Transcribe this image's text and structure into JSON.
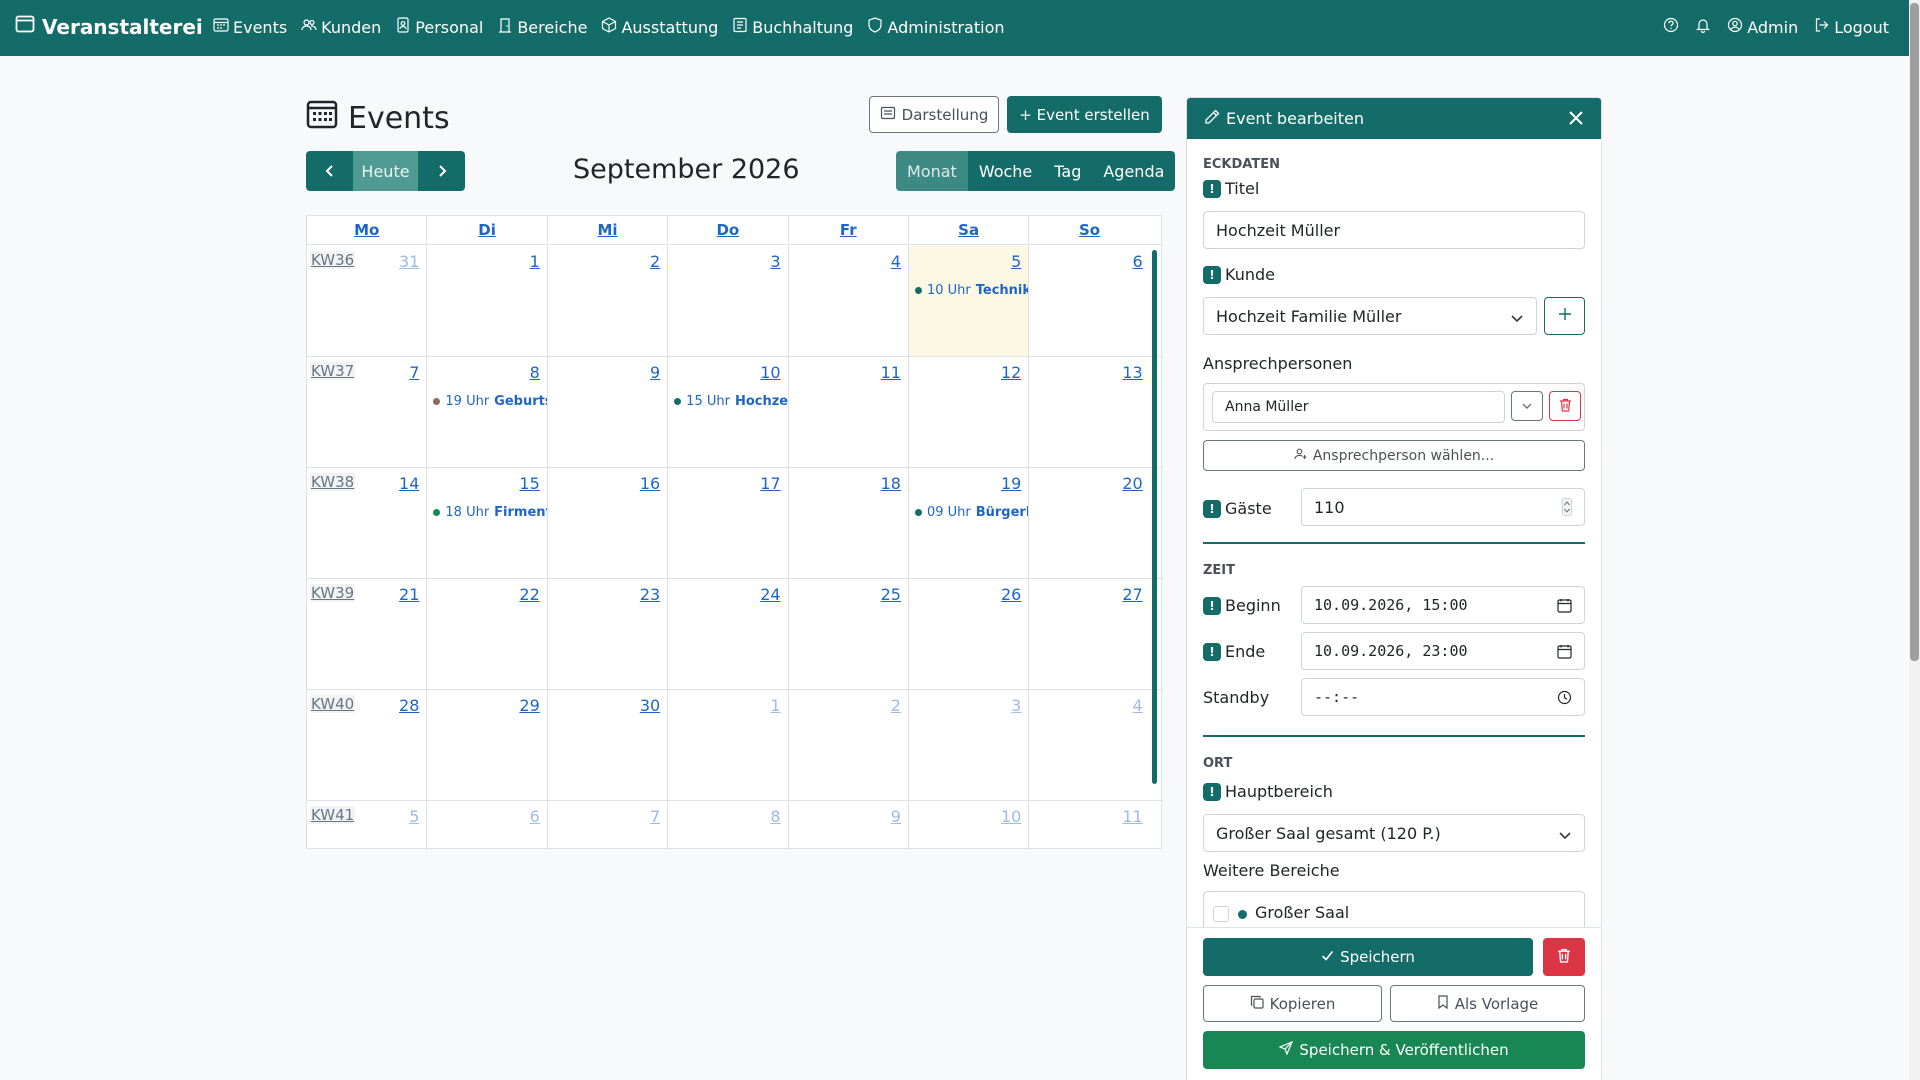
{
  "brand": "Veranstalterei",
  "nav": {
    "items": [
      "Events",
      "Kunden",
      "Personal",
      "Bereiche",
      "Ausstattung",
      "Buchhaltung",
      "Administration"
    ],
    "user": "Admin",
    "logout": "Logout"
  },
  "page": {
    "title": "Events",
    "darstellung": "Darstellung",
    "create": "+ Event erstellen"
  },
  "calendar": {
    "month_label": "September 2026",
    "today_label": "Heute",
    "views": [
      "Monat",
      "Woche",
      "Tag",
      "Agenda"
    ],
    "active_view": "Monat",
    "weekdays": [
      "Mo",
      "Di",
      "Mi",
      "Do",
      "Fr",
      "Sa",
      "So"
    ],
    "weeks": [
      {
        "kw": "KW36",
        "days": [
          "31",
          "1",
          "2",
          "3",
          "4",
          "5",
          "6"
        ]
      },
      {
        "kw": "KW37",
        "days": [
          "7",
          "8",
          "9",
          "10",
          "11",
          "12",
          "13"
        ]
      },
      {
        "kw": "KW38",
        "days": [
          "14",
          "15",
          "16",
          "17",
          "18",
          "19",
          "20"
        ]
      },
      {
        "kw": "KW39",
        "days": [
          "21",
          "22",
          "23",
          "24",
          "25",
          "26",
          "27"
        ]
      },
      {
        "kw": "KW40",
        "days": [
          "28",
          "29",
          "30",
          "1",
          "2",
          "3",
          "4"
        ]
      },
      {
        "kw": "KW41",
        "days": [
          "5",
          "6",
          "7",
          "8",
          "9",
          "10",
          "11"
        ]
      }
    ],
    "events": [
      {
        "week": 0,
        "day": 5,
        "time": "10 Uhr",
        "title": "Technikc",
        "color": "#146c68"
      },
      {
        "week": 1,
        "day": 1,
        "time": "19 Uhr",
        "title": "Geburtst",
        "color": "#8a6d5a"
      },
      {
        "week": 1,
        "day": 3,
        "time": "15 Uhr",
        "title": "Hochzeit",
        "color": "#146c68"
      },
      {
        "week": 2,
        "day": 1,
        "time": "18 Uhr",
        "title": "Firmenfe",
        "color": "#198754"
      },
      {
        "week": 2,
        "day": 5,
        "time": "09 Uhr",
        "title": "Bürgerkc",
        "color": "#146c68"
      }
    ]
  },
  "panel": {
    "header": "Event bearbeiten",
    "sections": {
      "eckdaten": "ECKDATEN",
      "zeit": "ZEIT",
      "ort": "ORT"
    },
    "labels": {
      "titel": "Titel",
      "kunde": "Kunde",
      "ansprechpersonen": "Ansprechpersonen",
      "gaeste": "Gäste",
      "beginn": "Beginn",
      "ende": "Ende",
      "standby": "Standby",
      "hauptbereich": "Hauptbereich",
      "weitere": "Weitere Bereiche"
    },
    "values": {
      "titel": "Hochzeit Müller",
      "kunde": "Hochzeit Familie Müller",
      "ansprechperson": "Anna Müller",
      "ansprechperson_waehlen": "Ansprechperson wählen...",
      "gaeste": "110",
      "beginn": "10.09.2026, 15:00",
      "ende": "10.09.2026, 23:00",
      "standby": "--:--",
      "hauptbereich": "Großer Saal gesamt (120 P.)",
      "weiterer_bereich": "Großer Saal"
    },
    "req_mark": "!",
    "buttons": {
      "save": "Speichern",
      "copy": "Kopieren",
      "template": "Als Vorlage",
      "save_publish": "Speichern & Veröffentlichen"
    }
  },
  "colors": {
    "primary": "#146c68",
    "link": "#1e66c6",
    "danger": "#dc3545",
    "success": "#198754",
    "today_bg": "#fcf8e3"
  }
}
